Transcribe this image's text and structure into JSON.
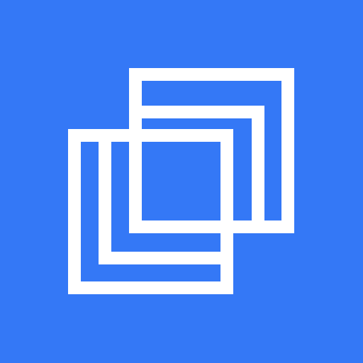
{
  "icon": {
    "name": "overlapping-squares-logo",
    "colors": {
      "background": "#3478F6",
      "foreground": "#FFFFFF"
    }
  }
}
